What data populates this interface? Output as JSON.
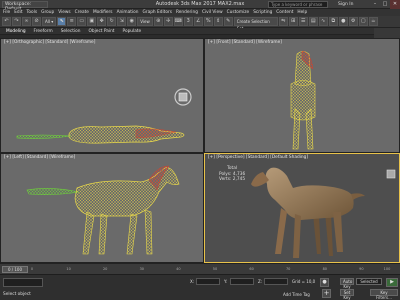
{
  "titlebar": {
    "workspace": "Workspace: Default",
    "title": "Autodesk 3ds Max 2017    MAX2.max",
    "search_placeholder": "Type a keyword or phrase",
    "signin": "Sign In"
  },
  "menu": [
    "File",
    "Edit",
    "Tools",
    "Group",
    "Views",
    "Create",
    "Modifiers",
    "Animation",
    "Graph Editors",
    "Rendering",
    "Civil View",
    "Customize",
    "Scripting",
    "Content",
    "Help"
  ],
  "toolbar": {
    "view_dropdown": "View",
    "selection_set": "Create Selection Set"
  },
  "ribbon": [
    "Modeling",
    "Freeform",
    "Selection",
    "Object Paint",
    "Populate"
  ],
  "viewports": {
    "top_label": "[+] [Orthographic] [Standard] [Wireframe]",
    "front_label": "[+] [Front] [Standard] [Wireframe]",
    "left_label": "[+] [Left] [Standard] [Wireframe]",
    "persp_label": "[+] [Perspective] [Standard] [Default Shading]",
    "stats": {
      "total_label": "Total",
      "polys_label": "Polys:",
      "polys_value": "4,736",
      "verts_label": "Verts:",
      "verts_value": "2,745"
    }
  },
  "timeline": {
    "frame": "0 / 100",
    "ticks": [
      "0",
      "10",
      "20",
      "30",
      "40",
      "50",
      "60",
      "70",
      "80",
      "90",
      "100"
    ]
  },
  "statusbar": {
    "selection_status": "Select object",
    "x_label": "X:",
    "y_label": "Y:",
    "z_label": "Z:",
    "grid": "Grid = 10,0",
    "add_time_tag": "Add Time Tag",
    "auto_key": "Auto Key",
    "set_key": "Set Key",
    "selected": "Selected",
    "key_filters": "Key Filters..."
  },
  "colors": {
    "wire_yellow": "#e8d84a",
    "wire_red": "#d8402a",
    "wire_green": "#6ed23a",
    "horse_brown": "#8a6a4a"
  }
}
